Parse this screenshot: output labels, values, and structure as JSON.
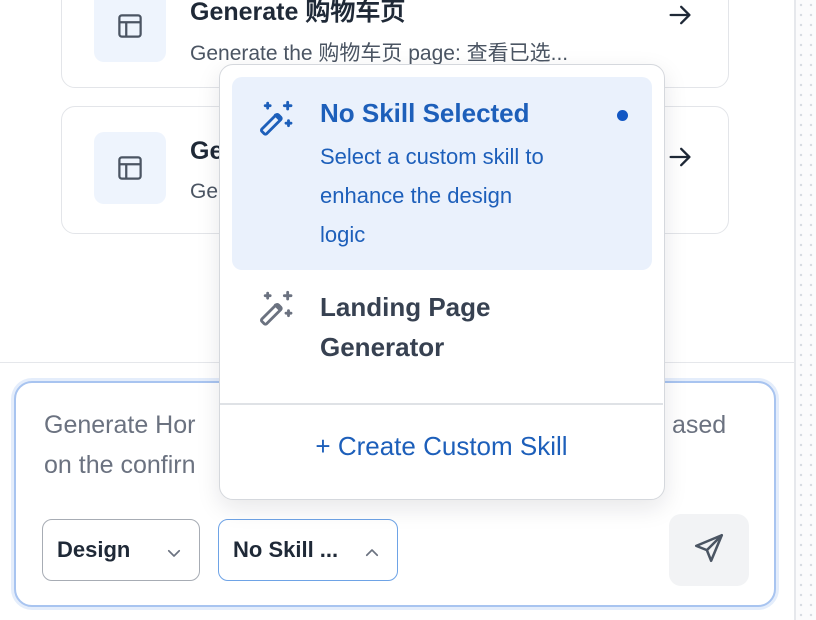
{
  "cards": [
    {
      "title": "Generate 购物车页",
      "subtitle": "Generate the 购物车页 page: 查看已选..."
    },
    {
      "title": "Ge",
      "subtitle": "Ge"
    }
  ],
  "composer": {
    "prompt_line1": "Generate Hor",
    "prompt_line1_tail": "ased",
    "prompt_line2": "on the confirn",
    "design_select": "Design",
    "skill_select": "No Skill ..."
  },
  "skill_menu": {
    "options": [
      {
        "title": "No Skill Selected",
        "description_lines": [
          "Select a custom skill to",
          "enhance the design",
          "logic"
        ],
        "selected": true
      },
      {
        "title_lines": [
          "Landing Page",
          "Generator"
        ],
        "selected": false
      }
    ],
    "create_label": "+ Create Custom Skill"
  },
  "colors": {
    "accent": "#1d5fba",
    "selected_bg": "#eaf1fc",
    "card_icon_bg": "#eef4fd",
    "input_border": "#a8c4f0"
  },
  "icons": {
    "card": "layout-icon",
    "arrow": "arrow-right-icon",
    "skill": "magic-wand-icon",
    "chevron_down": "chevron-down-icon",
    "chevron_up": "chevron-up-icon",
    "send": "send-icon"
  }
}
